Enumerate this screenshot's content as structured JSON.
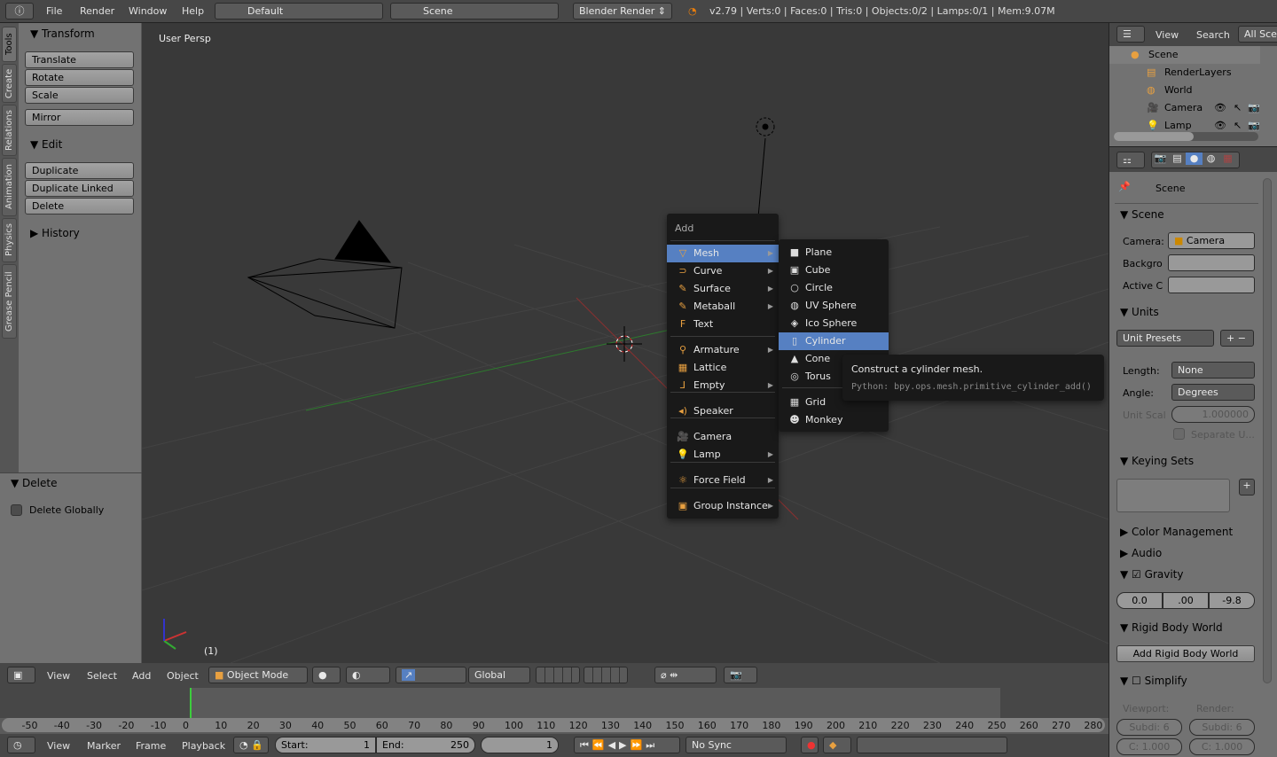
{
  "topbar": {
    "menus": [
      "File",
      "Render",
      "Window",
      "Help"
    ],
    "layout": "Default",
    "scene": "Scene",
    "engine": "Blender Render",
    "stats": "v2.79 | Verts:0 | Faces:0 | Tris:0 | Objects:0/2 | Lamps:0/1 | Mem:9.07M"
  },
  "tool_tabs": [
    "Tools",
    "Create",
    "Relations",
    "Animation",
    "Physics",
    "Grease Pencil"
  ],
  "toolshelf": {
    "transform_title": "Transform",
    "transform": [
      "Translate",
      "Rotate",
      "Scale"
    ],
    "mirror": "Mirror",
    "edit_title": "Edit",
    "edit": [
      "Duplicate",
      "Duplicate Linked",
      "Delete"
    ],
    "history_title": "History"
  },
  "operator": {
    "title": "Delete",
    "option": "Delete Globally",
    "checked": false
  },
  "viewport": {
    "label": "User Persp",
    "frame": "(1)"
  },
  "add_menu": {
    "title": "Add",
    "items": [
      {
        "label": "Mesh",
        "icon": "mesh-icon",
        "sub": true,
        "active": true
      },
      {
        "label": "Curve",
        "icon": "curve-icon",
        "sub": true
      },
      {
        "label": "Surface",
        "icon": "surface-icon",
        "sub": true
      },
      {
        "label": "Metaball",
        "icon": "metaball-icon",
        "sub": true
      },
      {
        "label": "Text",
        "icon": "text-icon",
        "sub": false
      },
      {
        "label": "Armature",
        "icon": "armature-icon",
        "sub": true
      },
      {
        "label": "Lattice",
        "icon": "lattice-icon",
        "sub": false
      },
      {
        "label": "Empty",
        "icon": "empty-icon",
        "sub": true
      },
      {
        "label": "Speaker",
        "icon": "speaker-icon",
        "sub": false
      },
      {
        "label": "Camera",
        "icon": "camera-icon",
        "sub": false
      },
      {
        "label": "Lamp",
        "icon": "lamp-icon",
        "sub": true
      },
      {
        "label": "Force Field",
        "icon": "force-field-icon",
        "sub": true
      },
      {
        "label": "Group Instance",
        "icon": "group-icon",
        "sub": true
      }
    ]
  },
  "mesh_menu": {
    "items": [
      {
        "label": "Plane",
        "icon": "plane-icon"
      },
      {
        "label": "Cube",
        "icon": "cube-icon"
      },
      {
        "label": "Circle",
        "icon": "circle-icon"
      },
      {
        "label": "UV Sphere",
        "icon": "uv-sphere-icon"
      },
      {
        "label": "Ico Sphere",
        "icon": "ico-sphere-icon"
      },
      {
        "label": "Cylinder",
        "icon": "cylinder-icon",
        "active": true
      },
      {
        "label": "Cone",
        "icon": "cone-icon"
      },
      {
        "label": "Torus",
        "icon": "torus-icon"
      },
      {
        "label": "Grid",
        "icon": "grid-icon"
      },
      {
        "label": "Monkey",
        "icon": "monkey-icon"
      }
    ]
  },
  "tooltip": {
    "title": "Construct a cylinder mesh.",
    "python": "Python: bpy.ops.mesh.primitive_cylinder_add()"
  },
  "view3d_header": {
    "menus": [
      "View",
      "Select",
      "Add",
      "Object"
    ],
    "mode": "Object Mode",
    "orientation": "Global"
  },
  "timeline": {
    "ticks": [
      "-50",
      "-40",
      "-30",
      "-20",
      "-10",
      "0",
      "10",
      "20",
      "30",
      "40",
      "50",
      "60",
      "70",
      "80",
      "90",
      "100",
      "110",
      "120",
      "130",
      "140",
      "150",
      "160",
      "170",
      "180",
      "190",
      "200",
      "210",
      "220",
      "230",
      "240",
      "250",
      "260",
      "270",
      "280"
    ],
    "current_frame": 0,
    "menus": [
      "View",
      "Marker",
      "Frame",
      "Playback"
    ],
    "start_label": "Start:",
    "start": "1",
    "end_label": "End:",
    "end": "250",
    "frame": "1",
    "sync": "No Sync"
  },
  "outliner": {
    "menus": [
      "View",
      "Search"
    ],
    "filter": "All Scenes",
    "items": [
      {
        "label": "Scene",
        "icon": "scene-icon"
      },
      {
        "label": "RenderLayers",
        "icon": "render-layers-icon"
      },
      {
        "label": "World",
        "icon": "world-icon"
      },
      {
        "label": "Camera",
        "icon": "camera-icon"
      },
      {
        "label": "Lamp",
        "icon": "lamp-icon"
      }
    ]
  },
  "properties": {
    "breadcrumb": "Scene",
    "scene_panel": "Scene",
    "camera_label": "Camera:",
    "camera": "Camera",
    "background_label": "Backgro",
    "active_clip_label": "Active C",
    "units_panel": "Units",
    "unit_presets": "Unit Presets",
    "length_label": "Length:",
    "length": "None",
    "angle_label": "Angle:",
    "angle": "Degrees",
    "unit_scale_label": "Unit Scal",
    "unit_scale": "1.000000",
    "separate_units": "Separate U...",
    "keying_sets": "Keying Sets",
    "color_management": "Color Management",
    "audio": "Audio",
    "gravity": "Gravity",
    "gravity_values": [
      "0.0",
      ".00",
      "-9.8"
    ],
    "rigid_body_world": "Rigid Body World",
    "add_rigid_body_world": "Add Rigid Body World",
    "simplify": "Simplify",
    "viewport_label": "Viewport:",
    "render_label": "Render:",
    "subdiv_vp": "Subdi: 6",
    "subdiv_r": "Subdi: 6",
    "child_vp": "C: 1.000",
    "child_r": "C: 1.000"
  },
  "colors": {
    "accent": "#5680c2",
    "viewport_bg": "#393939",
    "panel_bg": "#727272",
    "menu_bg": "#191919"
  }
}
